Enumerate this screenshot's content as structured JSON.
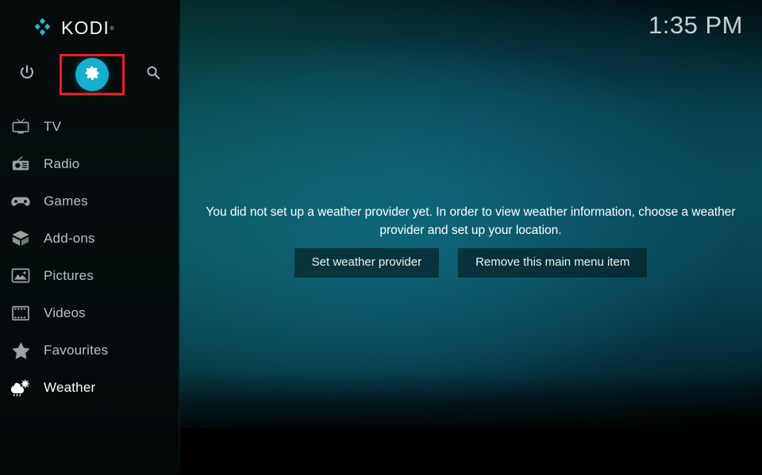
{
  "app": {
    "logo_text": "KODI",
    "logo_tm": "®",
    "logo_mark_color": "#2ab5d8",
    "accent_color": "#17afce",
    "annotation_color": "#ee1c21"
  },
  "topbar": {
    "clock": "1:35 PM",
    "buttons": [
      {
        "name": "power",
        "icon": "power-icon",
        "label": "Power"
      },
      {
        "name": "settings",
        "icon": "gear-icon",
        "label": "Settings",
        "highlighted": true
      },
      {
        "name": "search",
        "icon": "search-icon",
        "label": "Search"
      }
    ]
  },
  "sidebar": {
    "items": [
      {
        "label": "TV",
        "icon": "tv-icon",
        "active": false
      },
      {
        "label": "Radio",
        "icon": "radio-icon",
        "active": false
      },
      {
        "label": "Games",
        "icon": "gamepad-icon",
        "active": false
      },
      {
        "label": "Add-ons",
        "icon": "addons-box-icon",
        "active": false
      },
      {
        "label": "Pictures",
        "icon": "pictures-icon",
        "active": false
      },
      {
        "label": "Videos",
        "icon": "videos-film-icon",
        "active": false
      },
      {
        "label": "Favourites",
        "icon": "star-icon",
        "active": false
      },
      {
        "label": "Weather",
        "icon": "weather-icon",
        "active": true
      }
    ]
  },
  "main": {
    "message": "You did not set up a weather provider yet. In order to view weather information, choose a weather provider and set up your location.",
    "buttons": [
      {
        "label": "Set weather provider"
      },
      {
        "label": "Remove this main menu item"
      }
    ]
  }
}
